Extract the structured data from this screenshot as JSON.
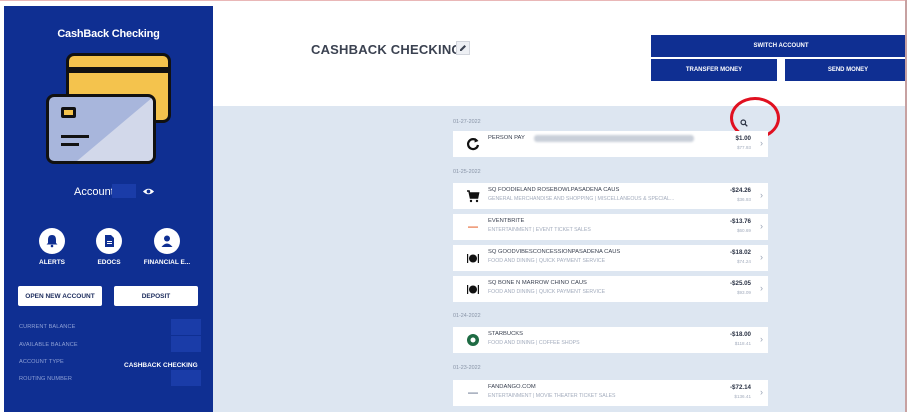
{
  "sidebar": {
    "title": "CashBack Checking",
    "account_label": "Account:",
    "quick_actions": [
      {
        "label": "ALERTS",
        "icon": "bell-icon"
      },
      {
        "label": "EDOCS",
        "icon": "document-icon"
      },
      {
        "label": "FINANCIAL E...",
        "icon": "person-badge-icon"
      }
    ],
    "open_account_label": "OPEN NEW ACCOUNT",
    "deposit_label": "DEPOSIT",
    "details": {
      "current_balance": "CURRENT BALANCE",
      "available_balance": "AVAILABLE BALANCE",
      "account_type": "ACCOUNT TYPE",
      "account_type_value": "CASHBACK CHECKING",
      "routing_number": "ROUTING NUMBER"
    }
  },
  "header": {
    "title": "CASHBACK CHECKING",
    "switch_account": "SWITCH ACCOUNT",
    "transfer_money": "TRANSFER MONEY",
    "send_money": "SEND MONEY"
  },
  "colors": {
    "sidebar_bg": "#0f2f92",
    "content_bg": "#dde6f1",
    "highlight": "#e01020"
  },
  "transactions": {
    "groups": [
      {
        "date": "01-27-2022",
        "items": [
          {
            "name": "PERSON PAY",
            "category": "",
            "amount": "$1.00",
            "balance": "$77.93",
            "icon": "refresh-icon"
          }
        ]
      },
      {
        "date": "01-25-2022",
        "items": [
          {
            "name": "SQ FOODIELAND ROSEBOWLPASADENA CAUS",
            "category": "GENERAL MERCHANDISE AND SHOPPING | MISCELLANEOUS & SPECIAL...",
            "amount": "-$24.26",
            "balance": "$36.93",
            "icon": "cart-icon"
          },
          {
            "name": "EVENTBRITE",
            "category": "ENTERTAINMENT | EVENT TICKET SALES",
            "amount": "-$13.76",
            "balance": "$60.69",
            "icon": "dash-icon"
          },
          {
            "name": "SQ GOODVIBESCONCESSIONPASADENA CAUS",
            "category": "FOOD AND DINING | QUICK PAYMENT SERVICE",
            "amount": "-$18.02",
            "balance": "$74.24",
            "icon": "dining-icon"
          },
          {
            "name": "SQ BONE N MARROW CHINO CAUS",
            "category": "FOOD AND DINING | QUICK PAYMENT SERVICE",
            "amount": "-$25.05",
            "balance": "$93.09",
            "icon": "dining-icon"
          }
        ]
      },
      {
        "date": "01-24-2022",
        "items": [
          {
            "name": "STARBUCKS",
            "category": "FOOD AND DINING | COFFEE SHOPS",
            "amount": "-$18.00",
            "balance": "$118.41",
            "icon": "starbucks-icon"
          }
        ]
      },
      {
        "date": "01-23-2022",
        "items": [
          {
            "name": "FANDANGO.COM",
            "category": "ENTERTAINMENT | MOVIE THEATER TICKET SALES",
            "amount": "-$72.14",
            "balance": "$136.41",
            "icon": "dash-icon"
          }
        ]
      }
    ]
  }
}
